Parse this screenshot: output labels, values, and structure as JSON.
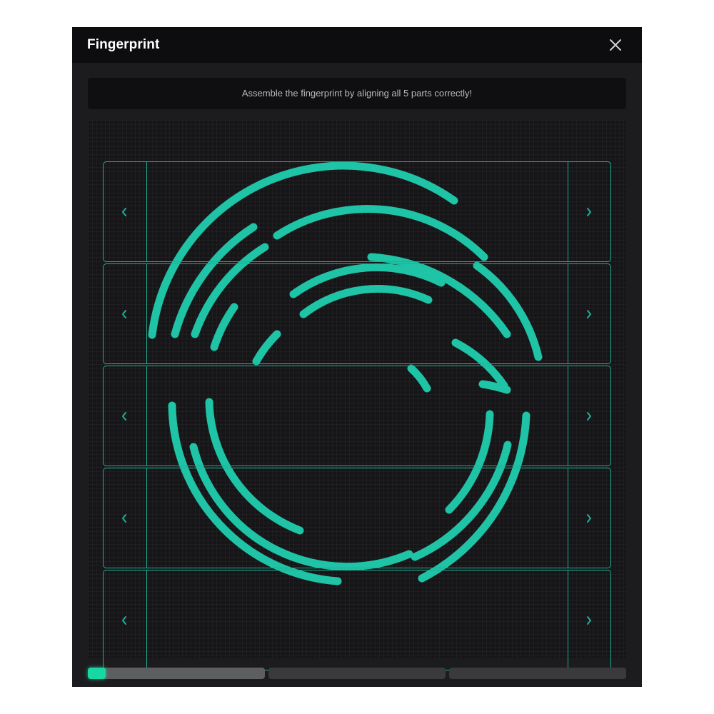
{
  "window": {
    "title": "Fingerprint"
  },
  "instructions": {
    "text": "Assemble the fingerprint by aligning all 5 parts correctly!"
  },
  "puzzle": {
    "strip_count": 5,
    "left_arrow_icon": "chevron-left-icon",
    "right_arrow_icon": "chevron-right-icon",
    "strips": [
      {
        "name": "strip-1"
      },
      {
        "name": "strip-2"
      },
      {
        "name": "strip-3"
      },
      {
        "name": "strip-4"
      },
      {
        "name": "strip-5"
      }
    ]
  },
  "progress": {
    "segments": 3,
    "current_segment": 1,
    "current_segment_fill": 0.1
  },
  "colors": {
    "accent": "#1fc3a5",
    "strip_border": "#1fae95",
    "progress_fill": "#17d7a2",
    "background": "#1c1c1e"
  }
}
